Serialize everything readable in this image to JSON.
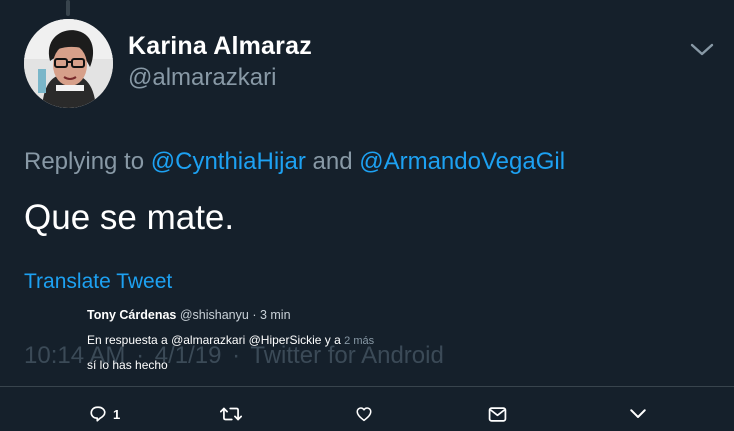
{
  "tweet": {
    "display_name": "Karina Almaraz",
    "handle": "@almarazkari",
    "replying_prefix": "Replying to",
    "replying_to": [
      "@CynthiaHijar",
      "@ArmandoVegaGil"
    ],
    "replying_and": "and",
    "text": "Que se mate.",
    "translate_label": "Translate Tweet",
    "time": "10:14 AM",
    "date": "4/1/19",
    "meta_sep": "·",
    "source": "Twitter for Android"
  },
  "overlay": {
    "name": "Tony Cárdenas",
    "handle": "@shishanyu",
    "time": "· 3 min",
    "reply_prefix": "En respuesta a",
    "reply_to": "@almarazkari @HiperSickie y a",
    "reply_more": "2 más",
    "text": "sí lo has hecho"
  },
  "actions": {
    "reply_count": "1",
    "icons": [
      "reply-icon",
      "retweet-icon",
      "like-icon",
      "message-icon",
      "chevron-down-icon"
    ]
  },
  "colors": {
    "background": "#15202b",
    "accent": "#1da1f2",
    "muted": "#8899a6",
    "divider": "#38444d"
  }
}
